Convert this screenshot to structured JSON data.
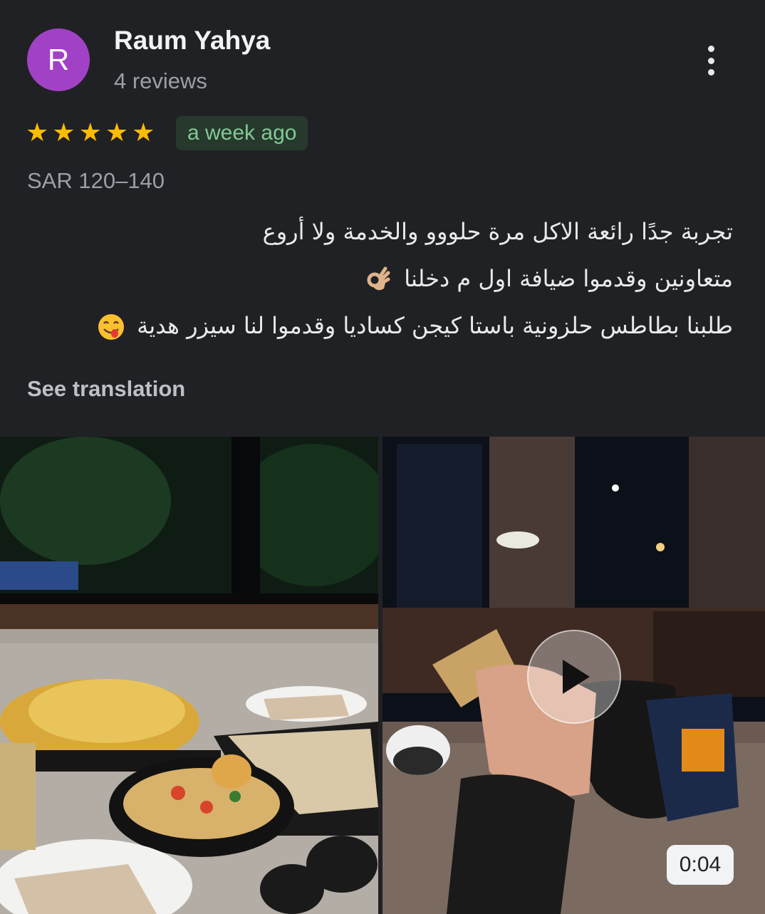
{
  "review": {
    "avatar_letter": "R",
    "avatar_color": "#a142c6",
    "author": "Raum Yahya",
    "review_count": "4 reviews",
    "rating": 5,
    "time_ago": "a week ago",
    "price_range": "SAR 120–140",
    "text_lines": [
      "تجربة جدًا رائعة الاكل مرة حلووو والخدمة ولا أروع",
      "متعاونين وقدموا ضيافة اول م دخلنا",
      "طلبنا بطاطس حلزونية باستا كيجن كساديا وقدموا لنا سيزر هدية"
    ],
    "see_translation": "See translation"
  },
  "media": {
    "photo_icon": "food-photo",
    "video_icon": "coffee-video",
    "video_duration": "0:04"
  },
  "colors": {
    "background": "#202124",
    "star": "#fbbc04",
    "badge_text": "#81c995",
    "badge_bg": "#27382c"
  }
}
